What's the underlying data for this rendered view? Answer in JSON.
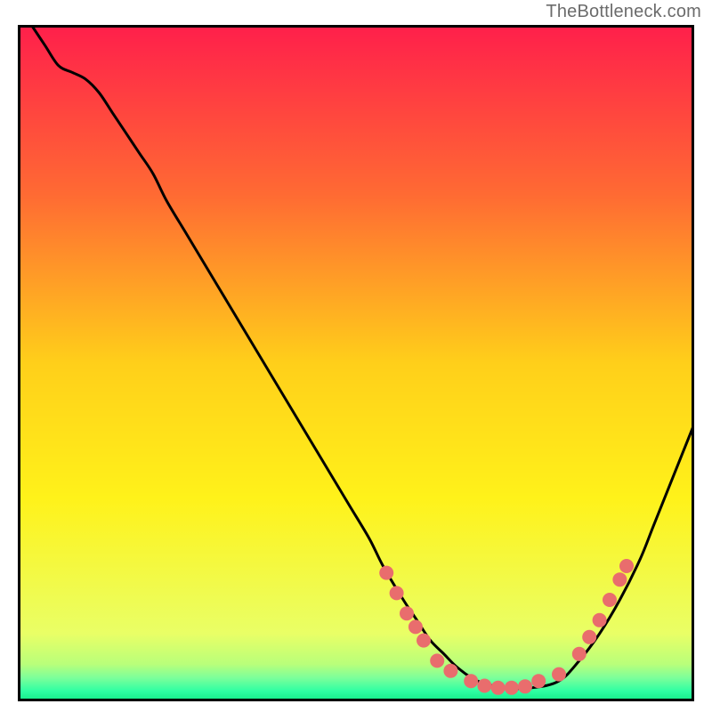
{
  "attribution": "TheBottleneck.com",
  "chart_data": {
    "type": "line",
    "title": "",
    "xlabel": "",
    "ylabel": "",
    "xlim": [
      0,
      100
    ],
    "ylim": [
      0,
      100
    ],
    "grid": false,
    "legend": false,
    "background_gradient": {
      "stops": [
        {
          "pos": 0.0,
          "color": "#ff1f4b"
        },
        {
          "pos": 0.25,
          "color": "#ff6a33"
        },
        {
          "pos": 0.5,
          "color": "#ffcf1a"
        },
        {
          "pos": 0.7,
          "color": "#fff21a"
        },
        {
          "pos": 0.9,
          "color": "#e9ff66"
        },
        {
          "pos": 0.945,
          "color": "#b9ff7a"
        },
        {
          "pos": 0.965,
          "color": "#7dff9a"
        },
        {
          "pos": 0.985,
          "color": "#2effa3"
        },
        {
          "pos": 1.0,
          "color": "#12e986"
        }
      ]
    },
    "series": [
      {
        "name": "bottleneck-curve",
        "x": [
          2,
          4,
          6,
          8,
          10,
          12,
          14,
          16,
          18,
          20,
          22,
          25,
          28,
          31,
          34,
          37,
          40,
          43,
          46,
          49,
          52,
          54,
          57,
          59,
          61,
          63,
          65,
          68,
          72,
          76,
          80,
          83,
          86,
          89,
          92,
          94,
          96,
          98,
          100
        ],
        "y": [
          100,
          97,
          94,
          93,
          92,
          90,
          87,
          84,
          81,
          78,
          74,
          69,
          64,
          59,
          54,
          49,
          44,
          39,
          34,
          29,
          24,
          20,
          15,
          12,
          9,
          7,
          5,
          3,
          2,
          2,
          3,
          6,
          10,
          15,
          21,
          26,
          31,
          36,
          41
        ]
      }
    ],
    "scatter_overlay": {
      "name": "highlight-points",
      "color": "#e96d6d",
      "points": [
        {
          "x": 54.5,
          "y": 19
        },
        {
          "x": 56.0,
          "y": 16
        },
        {
          "x": 57.5,
          "y": 13
        },
        {
          "x": 58.8,
          "y": 11
        },
        {
          "x": 60.0,
          "y": 9
        },
        {
          "x": 62.0,
          "y": 6
        },
        {
          "x": 64.0,
          "y": 4.5
        },
        {
          "x": 67.0,
          "y": 3
        },
        {
          "x": 69.0,
          "y": 2.3
        },
        {
          "x": 71.0,
          "y": 2
        },
        {
          "x": 73.0,
          "y": 2
        },
        {
          "x": 75.0,
          "y": 2.2
        },
        {
          "x": 77.0,
          "y": 3
        },
        {
          "x": 80.0,
          "y": 4
        },
        {
          "x": 83.0,
          "y": 7
        },
        {
          "x": 84.5,
          "y": 9.5
        },
        {
          "x": 86.0,
          "y": 12
        },
        {
          "x": 87.5,
          "y": 15
        },
        {
          "x": 89.0,
          "y": 18
        },
        {
          "x": 90.0,
          "y": 20
        }
      ]
    }
  }
}
